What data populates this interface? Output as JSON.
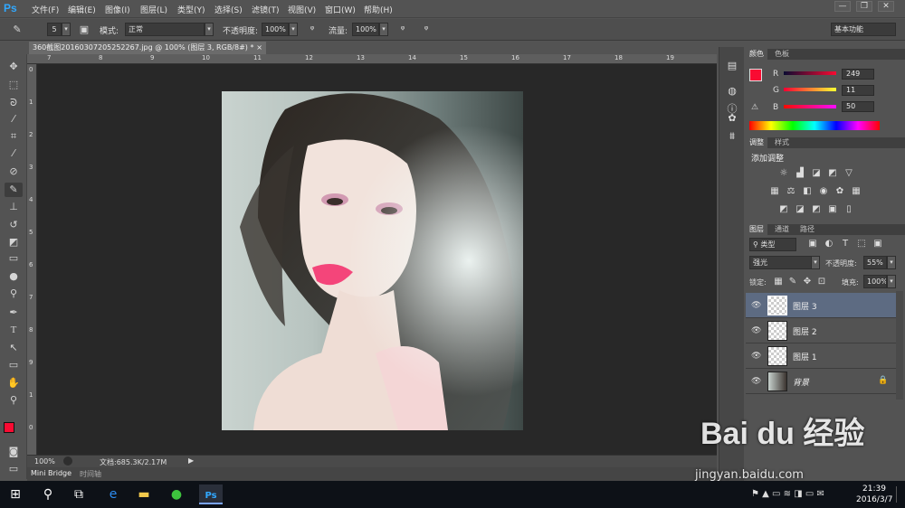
{
  "app": {
    "logo": "Ps"
  },
  "menu": [
    "文件(F)",
    "编辑(E)",
    "图像(I)",
    "图层(L)",
    "类型(Y)",
    "选择(S)",
    "滤镜(T)",
    "视图(V)",
    "窗口(W)",
    "帮助(H)"
  ],
  "window_controls": [
    "—",
    "❐",
    "✕"
  ],
  "options": {
    "brush_size": "5",
    "mode_label": "模式:",
    "mode_value": "正常",
    "opacity_label": "不透明度:",
    "opacity_value": "100%",
    "flow_label": "流量:",
    "flow_value": "100%",
    "workspace": "基本功能"
  },
  "document": {
    "tab_title": "360截图20160307205252267.jpg @ 100% (图层 3, RGB/8#) *",
    "zoom": "100%",
    "doc_info": "文档:685.3K/2.17M"
  },
  "ruler_numbers": [
    "7",
    "8",
    "9",
    "10",
    "11",
    "12",
    "13",
    "14",
    "15",
    "16",
    "17",
    "18",
    "19"
  ],
  "ruler_v_numbers": [
    "0",
    "1",
    "2",
    "3",
    "4",
    "5",
    "6",
    "7",
    "8",
    "9",
    "1",
    "0"
  ],
  "bottom_tabs": [
    "Mini Bridge",
    "时间轴"
  ],
  "color_panel": {
    "tabs": [
      "颜色",
      "色板"
    ],
    "r_label": "R",
    "r_value": "249",
    "g_label": "G",
    "g_value": "11",
    "b_label": "B",
    "b_value": "50",
    "foreground": "#f90b32"
  },
  "adjust_panel": {
    "tabs": [
      "调整",
      "样式"
    ],
    "title": "添加调整"
  },
  "layers_panel": {
    "tabs": [
      "图层",
      "通道",
      "路径"
    ],
    "filter_kind": "类型",
    "blend_mode": "强光",
    "opacity_label": "不透明度:",
    "opacity_value": "55%",
    "lock_label": "锁定:",
    "fill_label": "填充:",
    "fill_value": "100%",
    "layers": [
      {
        "name": "图层 3",
        "selected": true
      },
      {
        "name": "图层 2",
        "selected": false
      },
      {
        "name": "图层 1",
        "selected": false
      },
      {
        "name": "背景",
        "selected": false
      }
    ]
  },
  "taskbar": {
    "time": "21:39",
    "date": "2016/3/7"
  },
  "watermark": {
    "logo": "Bai du 经验",
    "url": "jingyan.baidu.com"
  }
}
